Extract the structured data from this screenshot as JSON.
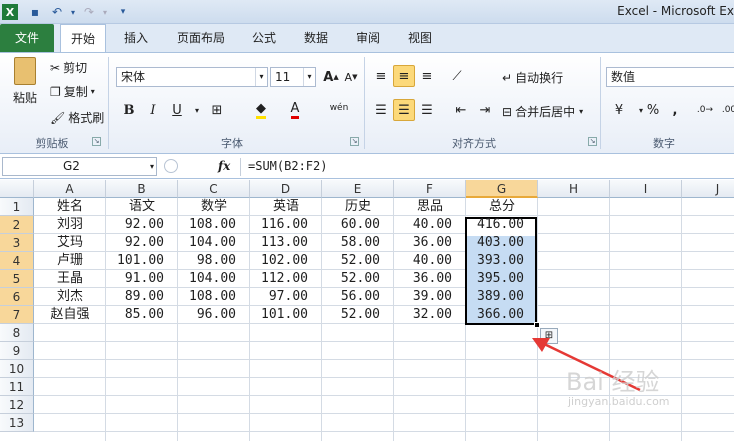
{
  "window": {
    "title": "Excel  -  Microsoft Ex"
  },
  "quick_access": {
    "icons": [
      "excel-logo-icon",
      "save-icon",
      "undo-icon",
      "redo-icon",
      "customize-icon"
    ]
  },
  "tabs": [
    "文件",
    "开始",
    "插入",
    "页面布局",
    "公式",
    "数据",
    "审阅",
    "视图"
  ],
  "clipboard": {
    "paste": "粘贴",
    "cut": "剪切",
    "copy": "复制",
    "format_painter": "格式刷",
    "group": "剪贴板"
  },
  "font": {
    "name": "宋体",
    "size": "11",
    "bold": "B",
    "italic": "I",
    "underline": "U",
    "group": "字体",
    "wen": "wén"
  },
  "alignment": {
    "wrap": "自动换行",
    "merge": "合并后居中",
    "group": "对齐方式"
  },
  "number": {
    "format": "数值",
    "percent": "%",
    "comma": ",",
    "group": "数字"
  },
  "formula_bar": {
    "name_box": "G2",
    "fx": "fx",
    "formula": "=SUM(B2:F2)"
  },
  "columns": [
    "A",
    "B",
    "C",
    "D",
    "E",
    "F",
    "G",
    "H",
    "I",
    "J"
  ],
  "rows": [
    "1",
    "2",
    "3",
    "4",
    "5",
    "6",
    "7",
    "8",
    "9",
    "10",
    "11",
    "12",
    "13"
  ],
  "table": {
    "header": [
      "姓名",
      "语文",
      "数学",
      "英语",
      "历史",
      "思品",
      "总分"
    ],
    "rows": [
      [
        "刘羽",
        "92.00",
        "108.00",
        "116.00",
        "60.00",
        "40.00",
        "416.00"
      ],
      [
        "艾玛",
        "92.00",
        "104.00",
        "113.00",
        "58.00",
        "36.00",
        "403.00"
      ],
      [
        "卢珊",
        "101.00",
        "98.00",
        "102.00",
        "52.00",
        "40.00",
        "393.00"
      ],
      [
        "王晶",
        "91.00",
        "104.00",
        "112.00",
        "52.00",
        "36.00",
        "395.00"
      ],
      [
        "刘杰",
        "89.00",
        "108.00",
        "97.00",
        "56.00",
        "39.00",
        "389.00"
      ],
      [
        "赵自强",
        "85.00",
        "96.00",
        "101.00",
        "52.00",
        "32.00",
        "366.00"
      ]
    ]
  },
  "colors": {
    "file_tab": "#2c7f3f",
    "selection": "#c6dcf3",
    "arrow": "#e53935"
  },
  "watermark": {
    "text": "Bai 经验",
    "url": "jingyan.baidu.com"
  }
}
